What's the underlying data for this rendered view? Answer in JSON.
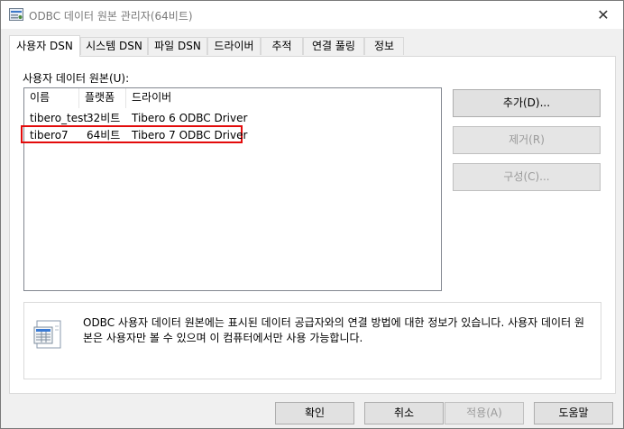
{
  "window": {
    "title": "ODBC 데이터 원본 관리자(64비트)",
    "close_label": "✕"
  },
  "tabs": [
    {
      "label": "사용자 DSN",
      "active": true
    },
    {
      "label": "시스템 DSN"
    },
    {
      "label": "파일 DSN"
    },
    {
      "label": "드라이버"
    },
    {
      "label": "추적"
    },
    {
      "label": "연결 풀링"
    },
    {
      "label": "정보"
    }
  ],
  "list": {
    "label": "사용자 데이터 원본(U):",
    "columns": [
      "이름",
      "플랫폼",
      "드라이버"
    ],
    "rows": [
      {
        "name": "tibero_test",
        "platform": "32비트",
        "driver": "Tibero 6 ODBC Driver",
        "highlighted": false
      },
      {
        "name": "tibero7",
        "platform": "64비트",
        "driver": "Tibero 7 ODBC Driver",
        "highlighted": true
      }
    ]
  },
  "side_buttons": {
    "add": {
      "label": "추가(D)...",
      "enabled": true
    },
    "remove": {
      "label": "제거(R)",
      "enabled": false
    },
    "configure": {
      "label": "구성(C)...",
      "enabled": false
    }
  },
  "info": {
    "icon": "data-source-document-icon",
    "text": "ODBC 사용자 데이터 원본에는 표시된 데이터 공급자와의 연결 방법에 대한 정보가 있습니다. 사용자 데이터 원본은 사용자만 볼 수 있으며 이 컴퓨터에서만 사용 가능합니다."
  },
  "bottom_buttons": {
    "ok": {
      "label": "확인",
      "enabled": true
    },
    "cancel": {
      "label": "취소",
      "enabled": true
    },
    "apply": {
      "label": "적용(A)",
      "enabled": false
    },
    "help": {
      "label": "도움말",
      "enabled": true
    }
  },
  "colors": {
    "highlight_border": "#e30b0b",
    "window_bg": "#f0f0f0",
    "disabled_text": "#9a9a9a"
  }
}
